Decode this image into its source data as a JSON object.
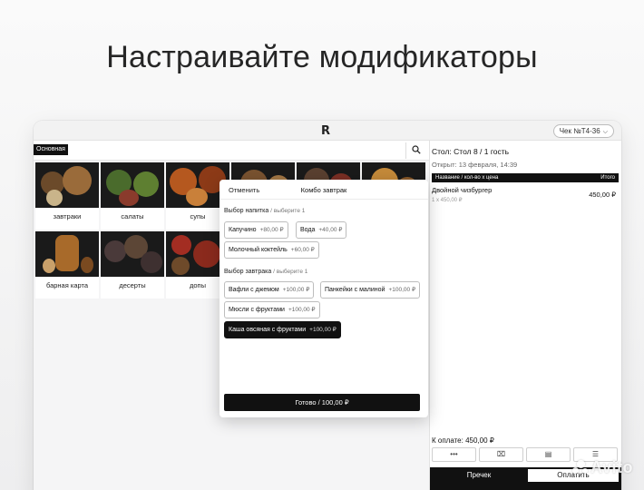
{
  "headline": "Настраивайте модификаторы",
  "app": {
    "logo": "R",
    "check_label": "Чек №Т4-36"
  },
  "menu": {
    "active_tab": "Основная",
    "categories": [
      {
        "label": "завтраки"
      },
      {
        "label": "салаты"
      },
      {
        "label": "супы"
      },
      {
        "label": ""
      },
      {
        "label": ""
      },
      {
        "label": ""
      },
      {
        "label": "барная карта"
      },
      {
        "label": "десерты"
      },
      {
        "label": "допы"
      }
    ]
  },
  "order": {
    "table": "Стол: Стол 8 / 1 гость",
    "opened": "Открыт: 13 февраля, 14:39",
    "col_name": "Название / кол-во x цена",
    "col_total": "Итого",
    "items": [
      {
        "name": "Двойной чизбургер",
        "qty": "1 x 450,00 ₽",
        "total": "450,00 ₽"
      }
    ],
    "to_pay": "К оплате: 450,00 ₽",
    "actions": [
      "•••",
      "⌧",
      "▤",
      "☰"
    ],
    "print_label": "Пречек",
    "pay_label": "Оплатить"
  },
  "modal": {
    "cancel": "Отменить",
    "title": "Комбо завтрак",
    "drink_section": "Выбор напитка",
    "drink_hint": "/ выберите 1",
    "drinks": [
      {
        "name": "Капучино",
        "price": "+80,00 ₽"
      },
      {
        "name": "Вода",
        "price": "+40,00 ₽"
      },
      {
        "name": "Молочный коктейль",
        "price": "+60,00 ₽"
      }
    ],
    "breakfast_section": "Выбор завтрака",
    "breakfast_hint": "/ выберите 1",
    "breakfasts": [
      {
        "name": "Вафли с джемом",
        "price": "+100,00 ₽"
      },
      {
        "name": "Панкейки с малиной",
        "price": "+100,00 ₽"
      },
      {
        "name": "Мюсли с фруктами",
        "price": "+100,00 ₽"
      },
      {
        "name": "Каша овсяная с фруктами",
        "price": "+100,00 ₽",
        "selected": true
      }
    ],
    "done": "Готово / 100,00 ₽"
  },
  "watermark": "Avito",
  "colors": {
    "accent": "#111111",
    "bg": "#f5f5f6"
  }
}
